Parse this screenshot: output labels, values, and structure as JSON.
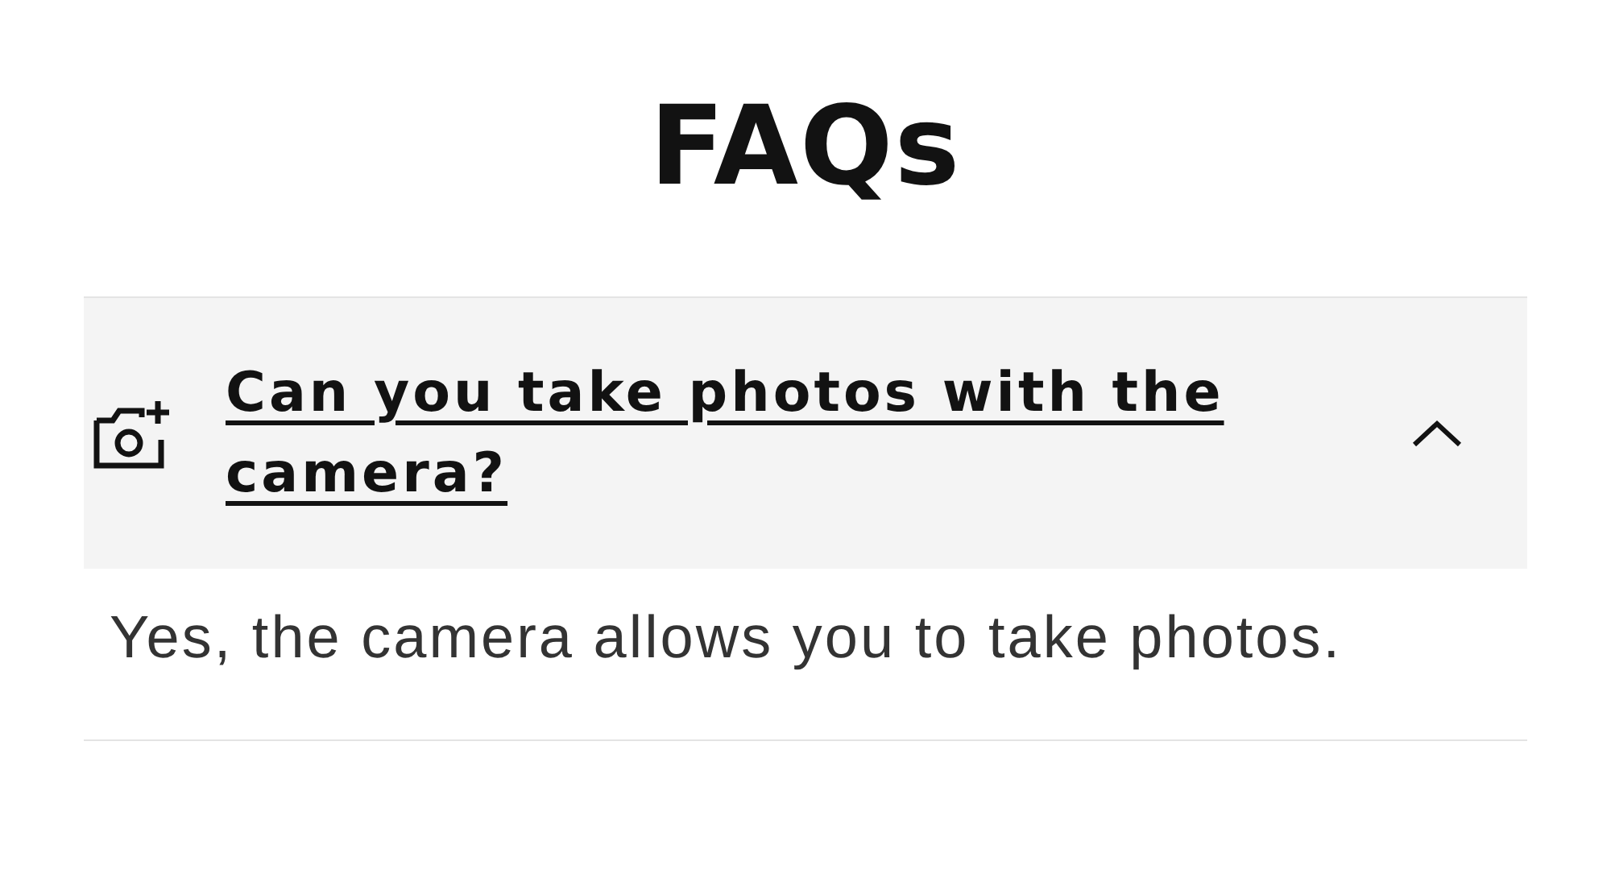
{
  "title": "FAQs",
  "faqs": [
    {
      "question": "Can you take photos with the camera?",
      "answer": "Yes, the camera allows you to take photos.",
      "expanded": true
    }
  ]
}
